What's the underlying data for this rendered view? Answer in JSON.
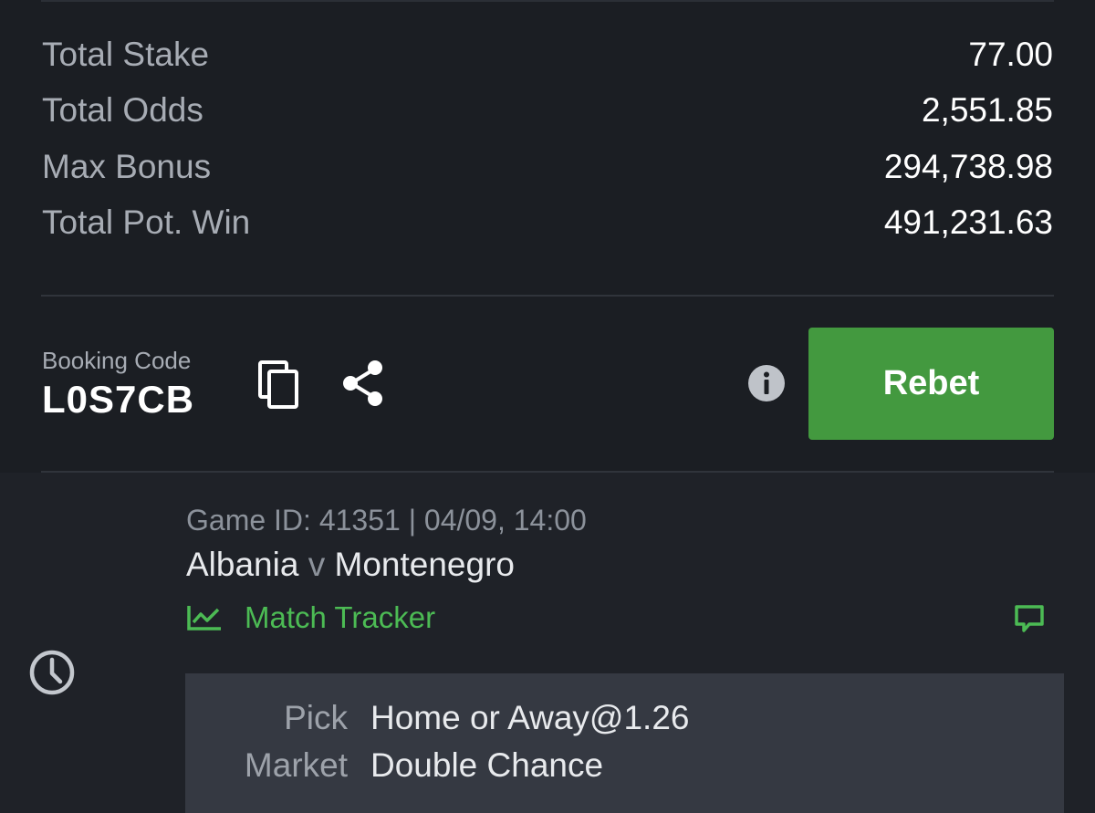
{
  "summary": {
    "rows": [
      {
        "label": "Total Stake",
        "value": "77.00"
      },
      {
        "label": "Total Odds",
        "value": "2,551.85"
      },
      {
        "label": "Max Bonus",
        "value": "294,738.98"
      },
      {
        "label": "Total Pot. Win",
        "value": "491,231.63"
      }
    ]
  },
  "booking": {
    "label": "Booking Code",
    "code": "L0S7CB",
    "rebet_label": "Rebet"
  },
  "icons": {
    "copy": "copy-icon",
    "share": "share-icon",
    "info": "info-icon",
    "clock": "clock-icon",
    "tracker": "chart-line-icon",
    "comment": "comment-icon"
  },
  "colors": {
    "accent_green": "#43993f",
    "tracker_green": "#4cbb54",
    "background": "#1b1e23",
    "detail_box": "#353942"
  },
  "selection": {
    "game_id": "Game ID: 41351 | 04/09, 14:00",
    "home": "Albania",
    "separator": "v",
    "away": "Montenegro",
    "tracker_label": "Match Tracker",
    "details": [
      {
        "key": "Pick",
        "value": "Home or Away@1.26"
      },
      {
        "key": "Market",
        "value": "Double Chance"
      }
    ]
  }
}
